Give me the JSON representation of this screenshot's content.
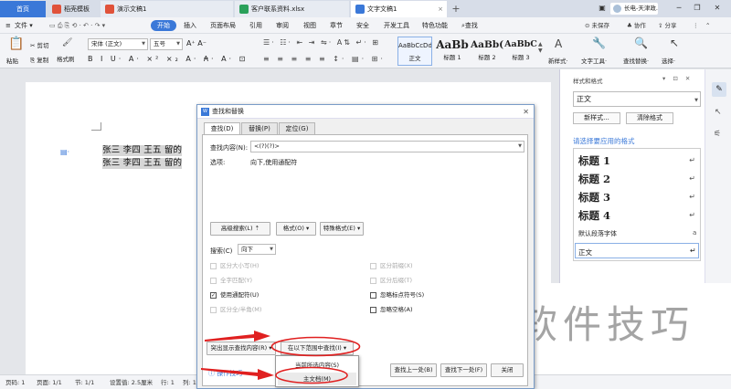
{
  "tabs": [
    {
      "label": "首页"
    },
    {
      "label": "稻壳模板",
      "color": "#e0523a"
    },
    {
      "label": "演示文稿1",
      "color": "#e0523a"
    },
    {
      "label": "客户联系资料.xlsx",
      "color": "#2aa05a"
    },
    {
      "label": "文字文稿1",
      "color": "#3a78d8"
    }
  ],
  "window_controls": {
    "user": "长电-天津政...",
    "minimize": "─",
    "maximize": "❐",
    "close": "✕",
    "layout": "▣"
  },
  "menu": {
    "file": "文件",
    "items": [
      "开始",
      "插入",
      "页面布局",
      "引用",
      "审阅",
      "视图",
      "章节",
      "安全",
      "开发工具",
      "特色功能"
    ],
    "search": "查找",
    "right": [
      "未保存",
      "协作",
      "分享"
    ]
  },
  "ribbon": {
    "paste": "粘贴",
    "cut": "剪切",
    "copy": "复制",
    "format_painter": "格式刷",
    "font": "宋体 (正文)",
    "size": "五号",
    "styles": [
      {
        "preview": "AaBbCcDd",
        "label": "正文"
      },
      {
        "preview": "AaBb",
        "label": "标题 1"
      },
      {
        "preview": "AaBb(",
        "label": "标题 2"
      },
      {
        "preview": "AaBbC",
        "label": "标题 3"
      }
    ],
    "new_style": "新样式",
    "text_tools": "文字工具",
    "find_replace": "查找替换",
    "select": "选择"
  },
  "document": {
    "lines": [
      "张三  李四  王五  留的",
      "张三  李四  王五  留的  "
    ]
  },
  "right_panel": {
    "title": "样式和格式",
    "current": "正文",
    "new_style_btn": "新样式...",
    "clear_btn": "清除格式",
    "hint": "请选择要应用的格式",
    "styles": [
      "标题 1",
      "标题 2",
      "标题 3",
      "标题 4"
    ],
    "default_font": "默认段落字体",
    "normal": "正文"
  },
  "dialog": {
    "title": "查找和替换",
    "tabs": [
      "查找(D)",
      "替换(P)",
      "定位(G)"
    ],
    "find_label": "查找内容(N):",
    "find_value": "<(?)(?)>",
    "options_label": "选项:",
    "options_value": "向下,使用通配符",
    "advanced": "高级搜索(L)",
    "format": "格式(O)",
    "special": "特殊格式(E)",
    "search_label": "搜索(C)",
    "search_value": "向下",
    "checkboxes_left": [
      {
        "label": "区分大小写(H)",
        "checked": false
      },
      {
        "label": "全字匹配(Y)",
        "checked": false
      },
      {
        "label": "使用通配符(U)",
        "checked": true
      },
      {
        "label": "区分全/半角(M)",
        "checked": false
      }
    ],
    "checkboxes_right": [
      {
        "label": "区分前缀(X)",
        "checked": false
      },
      {
        "label": "区分后缀(T)",
        "checked": false
      },
      {
        "label": "忽略标点符号(S)",
        "checked": false
      },
      {
        "label": "忽略空格(A)",
        "checked": false
      }
    ],
    "highlight_btn": "突出显示查找内容(R)",
    "scope_btn": "在以下范围中查找(I)",
    "tips": "操作技巧",
    "prev": "查找上一处(B)",
    "next": "查找下一处(F)",
    "close": "关闭"
  },
  "scope_menu": [
    "当前所选内容(S)",
    "主文档(M)"
  ],
  "status": {
    "pages": "页码: 1",
    "page": "页面: 1/1",
    "section": "节: 1/1",
    "setting": "设置值: 2.5厘米",
    "row": "行: 1",
    "col": "列: 1"
  },
  "watermark": "软件技巧",
  "colors": {
    "accent": "#3a78d8",
    "annotation": "#e02020",
    "dialog_border": "#7a9cc8"
  }
}
